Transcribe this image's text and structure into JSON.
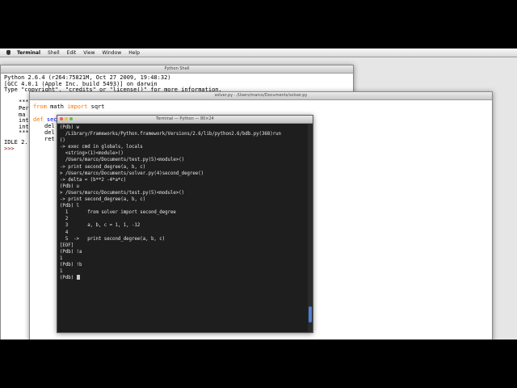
{
  "menubar": {
    "app": "Terminal",
    "items": [
      "Shell",
      "Edit",
      "View",
      "Window",
      "Help"
    ]
  },
  "python_shell": {
    "title": "Python Shell",
    "lines": [
      "Python 2.6.4 (r264:75821M, Oct 27 2009, 19:48:32)",
      "[GCC 4.0.1 (Apple Inc. build 5493)] on darwin",
      "Type \"copyright\", \"credits\" or \"license()\" for more information."
    ],
    "partial": [
      "***",
      "Per",
      "ma",
      "int",
      "int",
      "***"
    ],
    "idle_line": "IDLE 2.",
    "prompt": ">>>"
  },
  "editor": {
    "title": "solver.py - /Users/marco/Documents/solver.py",
    "line1": "from math import sqrt",
    "def_line": "def second_degree(a, b, c):",
    "partial": [
      "del",
      "del",
      "ret"
    ]
  },
  "terminal": {
    "title": "Terminal — Python — 80×24",
    "lines": [
      "(Pdb) w",
      "  /Library/Frameworks/Python.framework/Versions/2.6/lib/python2.6/bdb.py(368)run",
      "()",
      "-> exec cmd in globals, locals",
      "  <string>(1)<module>()",
      "  /Users/marco/Documents/test.py(5)<module>()",
      "-> print second_degree(a, b, c)",
      "> /Users/marco/Documents/solver.py(4)second_degree()",
      "-> delta = (b**2 -4*a*c)",
      "(Pdb) u",
      "> /Users/marco/Documents/test.py(5)<module>()",
      "-> print second_degree(a, b, c)",
      "(Pdb) l",
      "  1       from solver import second_degree",
      "  2",
      "  3       a, b, c = 1, 1, -12",
      "  4",
      "  5  ->   print second_degree(a, b, c)",
      "[EOF]",
      "(Pdb) !a",
      "1",
      "(Pdb) !b",
      "1"
    ],
    "prompt": "(Pdb) ",
    "light_colors": [
      "#ec5f58",
      "#f6be3a",
      "#5ec148"
    ]
  }
}
